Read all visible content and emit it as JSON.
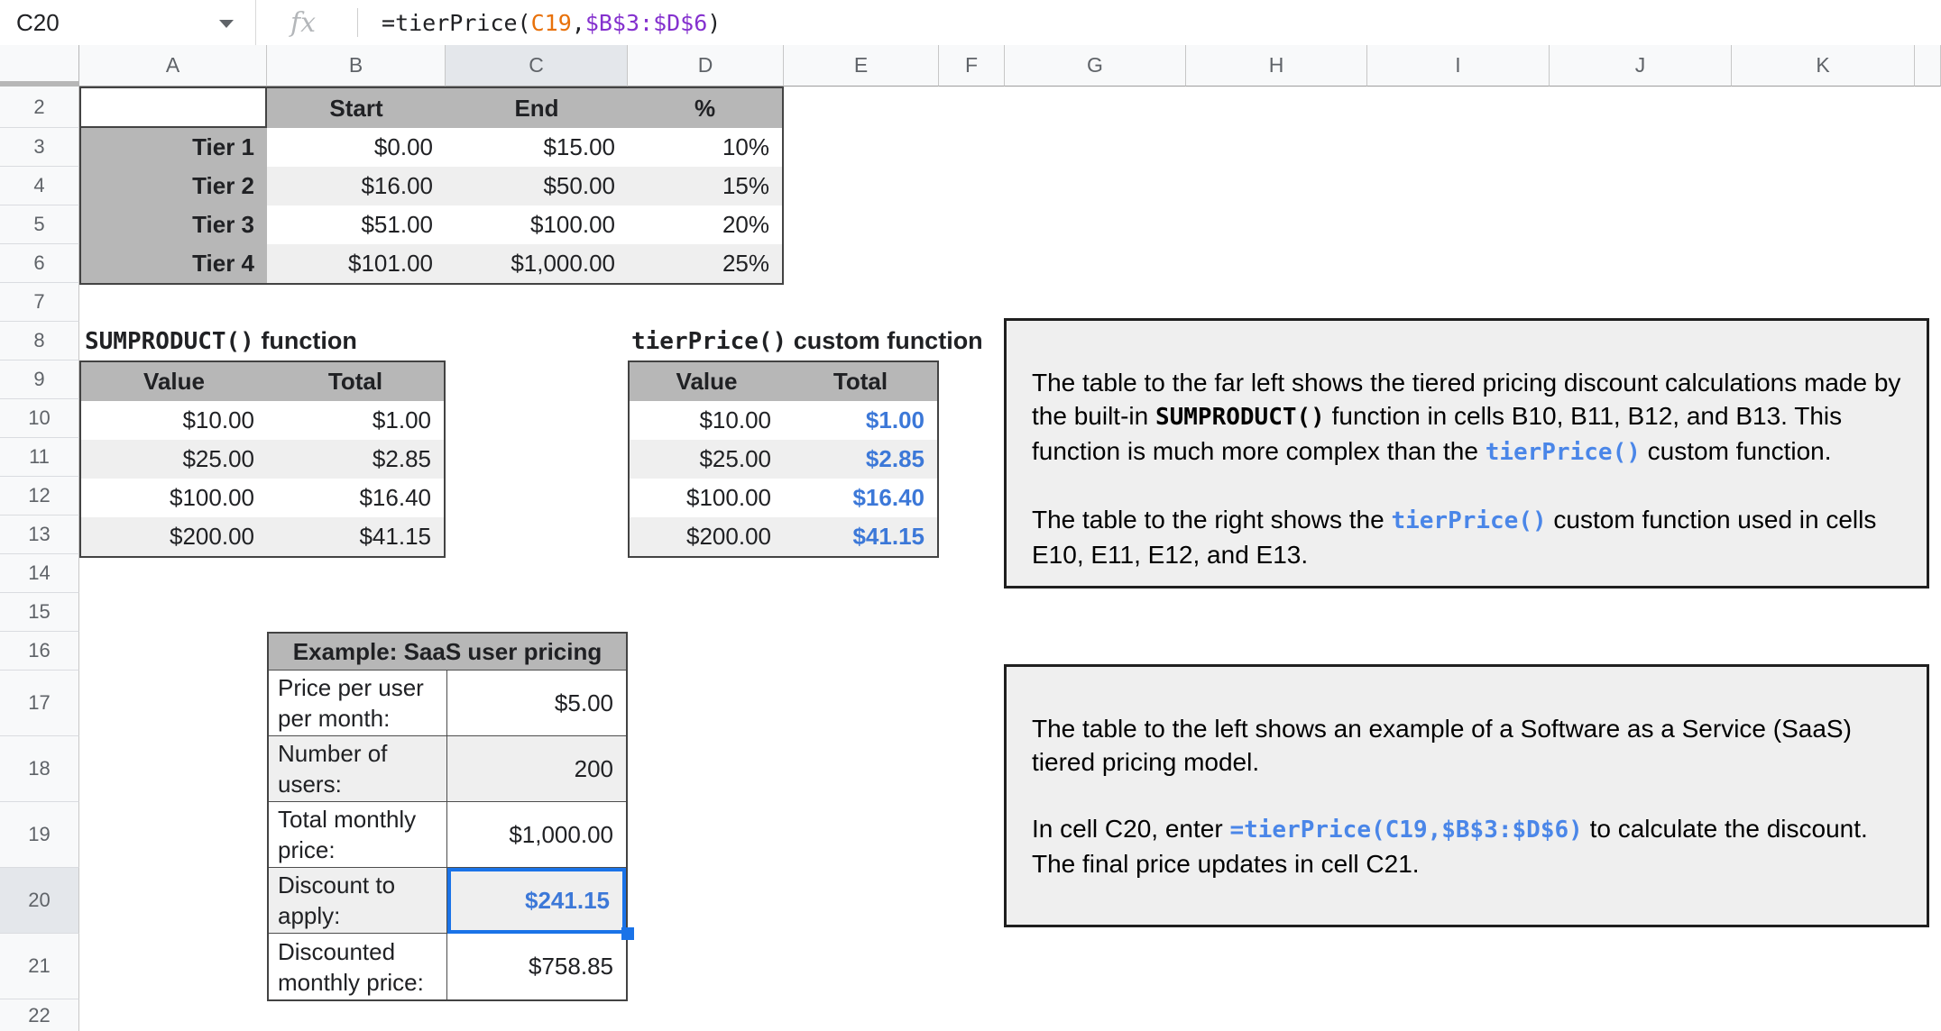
{
  "formula_bar": {
    "cell_reference": "C20",
    "fx_label": "fx",
    "formula_runs": [
      {
        "t": "=tierPrice(",
        "c": "#202124"
      },
      {
        "t": "C19",
        "c": "#e8710a"
      },
      {
        "t": ",",
        "c": "#202124"
      },
      {
        "t": "$B$3:$D$6",
        "c": "#8430ce"
      },
      {
        "t": ")",
        "c": "#202124"
      }
    ]
  },
  "grid": {
    "column_letters": [
      "A",
      "B",
      "C",
      "D",
      "E",
      "F",
      "G",
      "H",
      "I",
      "J",
      "K"
    ],
    "row_numbers": [
      "2",
      "3",
      "4",
      "5",
      "6",
      "7",
      "8",
      "9",
      "10",
      "11",
      "12",
      "13",
      "14",
      "15",
      "16",
      "17",
      "18",
      "19",
      "20",
      "21",
      "22"
    ],
    "selected_cell": "C20",
    "selected_column": "C",
    "selected_row": "20"
  },
  "colors": {
    "header_fill": "#b7b7b7",
    "band_fill": "#efefef",
    "selection_blue": "#1a73e8",
    "value_blue": "#3c78d8",
    "code_blue": "#4a86e8",
    "formula_arg_orange": "#e8710a",
    "formula_range_purple": "#8430ce"
  },
  "tier_table": {
    "headers": {
      "start": "Start",
      "end": "End",
      "pct": "%"
    },
    "rows": [
      {
        "label": "Tier 1",
        "start": "$0.00",
        "end": "$15.00",
        "pct": "10%"
      },
      {
        "label": "Tier 2",
        "start": "$16.00",
        "end": "$50.00",
        "pct": "15%"
      },
      {
        "label": "Tier 3",
        "start": "$51.00",
        "end": "$100.00",
        "pct": "20%"
      },
      {
        "label": "Tier 4",
        "start": "$101.00",
        "end": "$1,000.00",
        "pct": "25%"
      }
    ]
  },
  "sumproduct_section": {
    "title_code": "SUMPRODUCT()",
    "title_rest": " function",
    "headers": {
      "value": "Value",
      "total": "Total"
    },
    "rows": [
      {
        "value": "$10.00",
        "total": "$1.00"
      },
      {
        "value": "$25.00",
        "total": "$2.85"
      },
      {
        "value": "$100.00",
        "total": "$16.40"
      },
      {
        "value": "$200.00",
        "total": "$41.15"
      }
    ]
  },
  "tierprice_section": {
    "title_code": "tierPrice()",
    "title_rest": " custom function",
    "headers": {
      "value": "Value",
      "total": "Total"
    },
    "rows": [
      {
        "value": "$10.00",
        "total": "$1.00"
      },
      {
        "value": "$25.00",
        "total": "$2.85"
      },
      {
        "value": "$100.00",
        "total": "$16.40"
      },
      {
        "value": "$200.00",
        "total": "$41.15"
      }
    ]
  },
  "saas_table": {
    "title": "Example: SaaS user pricing",
    "rows": [
      {
        "label": "Price per user per month:",
        "value": "$5.00"
      },
      {
        "label": "Number of users:",
        "value": "200"
      },
      {
        "label": "Total monthly price:",
        "value": "$1,000.00"
      },
      {
        "label": "Discount to apply:",
        "value": "$241.15"
      },
      {
        "label": "Discounted monthly price:",
        "value": "$758.85"
      }
    ]
  },
  "note_sumproduct": {
    "p1": [
      {
        "t": "The table to the far left shows the tiered pricing discount calculations made by the built-in ",
        "s": "plain"
      },
      {
        "t": "SUMPRODUCT()",
        "s": "code"
      },
      {
        "t": " function in cells B10, B11, B12, and B13. This function is much more complex than the ",
        "s": "plain"
      },
      {
        "t": "tierPrice()",
        "s": "code-blue"
      },
      {
        "t": " custom function.",
        "s": "plain"
      }
    ],
    "p2": [
      {
        "t": "The table to the right shows the ",
        "s": "plain"
      },
      {
        "t": "tierPrice()",
        "s": "code-blue"
      },
      {
        "t": " custom function used in cells E10, E11, E12, and E13.",
        "s": "plain"
      }
    ]
  },
  "note_saas": {
    "p1": [
      {
        "t": "The table to the left shows an example of a Software as a Service (SaaS) tiered pricing model.",
        "s": "plain"
      }
    ],
    "p2": [
      {
        "t": "In cell C20, enter ",
        "s": "plain"
      },
      {
        "t": "=tierPrice(C19,$B$3:$D$6)",
        "s": "code-blue"
      },
      {
        "t": " to calculate the discount. The final price updates in cell C21.",
        "s": "plain"
      }
    ]
  }
}
